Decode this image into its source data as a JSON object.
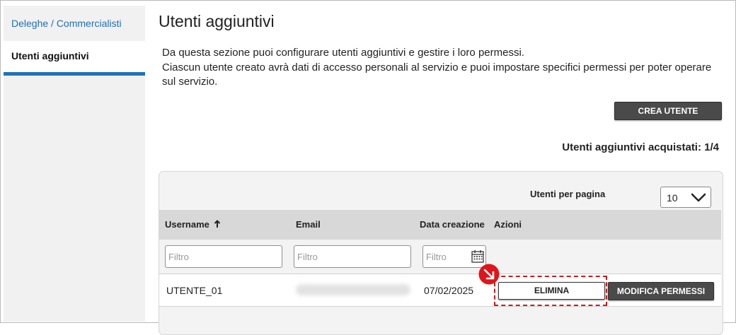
{
  "sidebar": {
    "items": [
      {
        "label": "Deleghe / Commercialisti"
      },
      {
        "label": "Utenti aggiuntivi"
      }
    ]
  },
  "main": {
    "title": "Utenti aggiuntivi",
    "description_line1": "Da questa sezione puoi configurare utenti aggiuntivi e gestire i loro permessi.",
    "description_line2": "Ciascun utente creato avrà dati di accesso personali al servizio e puoi impostare specifici permessi per poter operare sul servizio.",
    "create_button": "CREA UTENTE",
    "purchased": "Utenti aggiuntivi acquistati: 1/4"
  },
  "table": {
    "per_page_label": "Utenti per pagina",
    "per_page_value": "10",
    "columns": {
      "username": "Username",
      "email": "Email",
      "created": "Data creazione",
      "actions": "Azioni"
    },
    "filter_placeholder": "Filtro",
    "rows": [
      {
        "username": "UTENTE_01",
        "created": "07/02/2025",
        "delete_label": "ELIMINA",
        "modify_label": "MODIFICA PERMESSI"
      }
    ]
  },
  "colors": {
    "accent": "#1f73b7",
    "link": "#1f6fb2",
    "dark_button": "#4a4a4a",
    "highlight": "#d01a1a"
  }
}
